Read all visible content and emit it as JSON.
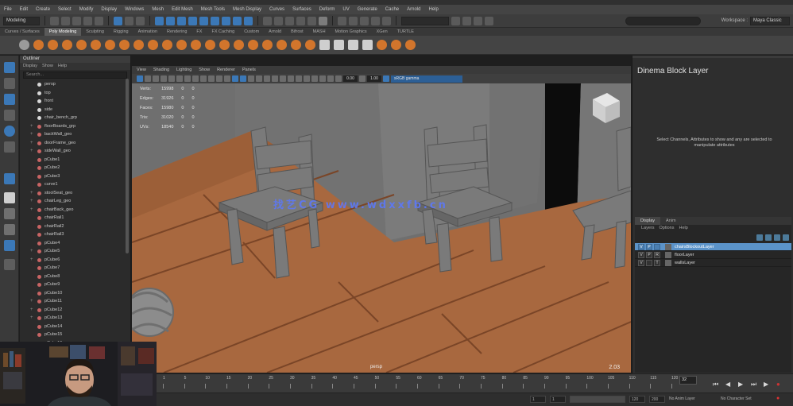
{
  "menubar": {
    "items": [
      "File",
      "Edit",
      "Create",
      "Select",
      "Modify",
      "Display",
      "Windows",
      "Mesh",
      "Edit Mesh",
      "Mesh Tools",
      "Mesh Display",
      "Curves",
      "Surfaces",
      "Deform",
      "UV",
      "Generate",
      "Cache",
      "Arnold",
      "Help"
    ]
  },
  "statusline": {
    "mode_value": "Modeling",
    "workspace_label": "Workspace :",
    "workspace_value": "Maya Classic"
  },
  "shelf_tabs": [
    "Curves / Surfaces",
    "Poly Modeling",
    "Sculpting",
    "Rigging",
    "Animation",
    "Rendering",
    "FX",
    "FX Caching",
    "Custom",
    "Arnold",
    "Bifrost",
    "MASH",
    "Motion Graphics",
    "XGen",
    "TURTLE"
  ],
  "active_shelf_tab_index": 1,
  "outliner": {
    "title": "Outliner",
    "menu": [
      "Display",
      "Show",
      "Help"
    ],
    "search_placeholder": "Search...",
    "items": [
      {
        "label": "persp",
        "expand": false,
        "icon": "camera"
      },
      {
        "label": "top",
        "expand": false,
        "icon": "camera"
      },
      {
        "label": "front",
        "expand": false,
        "icon": "camera"
      },
      {
        "label": "side",
        "expand": false,
        "icon": "camera"
      },
      {
        "label": "chair_bench_grp",
        "expand": false,
        "icon": "camera"
      },
      {
        "label": "floorBoards_grp",
        "expand": true,
        "icon": "mesh"
      },
      {
        "label": "backWall_geo",
        "expand": true,
        "icon": "mesh"
      },
      {
        "label": "doorFrame_geo",
        "expand": true,
        "icon": "mesh"
      },
      {
        "label": "sideWall_geo",
        "expand": true,
        "icon": "mesh"
      },
      {
        "label": "pCube1",
        "expand": false,
        "icon": "mesh"
      },
      {
        "label": "pCube2",
        "expand": false,
        "icon": "mesh"
      },
      {
        "label": "pCube3",
        "expand": false,
        "icon": "mesh"
      },
      {
        "label": "curve1",
        "expand": false,
        "icon": "curve"
      },
      {
        "label": "stoolSeat_geo",
        "expand": true,
        "icon": "mesh"
      },
      {
        "label": "chairLeg_geo",
        "expand": true,
        "icon": "mesh"
      },
      {
        "label": "chairBack_geo",
        "expand": true,
        "icon": "mesh"
      },
      {
        "label": "chairRail1",
        "expand": false,
        "icon": "mesh"
      },
      {
        "label": "chairRail2",
        "expand": false,
        "icon": "mesh"
      },
      {
        "label": "chairRail3",
        "expand": false,
        "icon": "mesh"
      },
      {
        "label": "pCube4",
        "expand": false,
        "icon": "mesh"
      },
      {
        "label": "pCube5",
        "expand": true,
        "icon": "mesh"
      },
      {
        "label": "pCube6",
        "expand": true,
        "icon": "mesh"
      },
      {
        "label": "pCube7",
        "expand": false,
        "icon": "mesh"
      },
      {
        "label": "pCube8",
        "expand": false,
        "icon": "mesh"
      },
      {
        "label": "pCube9",
        "expand": false,
        "icon": "mesh"
      },
      {
        "label": "pCube10",
        "expand": false,
        "icon": "mesh"
      },
      {
        "label": "pCube11",
        "expand": true,
        "icon": "mesh"
      },
      {
        "label": "pCube12",
        "expand": true,
        "icon": "mesh"
      },
      {
        "label": "pCube13",
        "expand": true,
        "icon": "mesh"
      },
      {
        "label": "pCube14",
        "expand": false,
        "icon": "mesh"
      },
      {
        "label": "pCube15",
        "expand": false,
        "icon": "mesh"
      },
      {
        "label": "pCube16",
        "expand": false,
        "icon": "mesh"
      }
    ]
  },
  "viewport": {
    "menu": [
      "View",
      "Shading",
      "Lighting",
      "Show",
      "Renderer",
      "Panels"
    ],
    "field1": "0.00",
    "field2": "1.00",
    "camera_value": "sRGB gamma",
    "hud": [
      {
        "k": "Verts:",
        "v": "15998",
        "a": "0",
        "b": "0"
      },
      {
        "k": "Edges:",
        "v": "31926",
        "a": "0",
        "b": "0"
      },
      {
        "k": "Faces:",
        "v": "15980",
        "a": "0",
        "b": "0"
      },
      {
        "k": "Tris:",
        "v": "31020",
        "a": "0",
        "b": "0"
      },
      {
        "k": "UVs:",
        "v": "18540",
        "a": "0",
        "b": "0"
      }
    ],
    "camera_label": "persp",
    "fps": "2.03",
    "watermark": "找艺CG  www.wdxxfb.cn"
  },
  "right_panel": {
    "title": "Dinema Block Layer",
    "message": "Select Channels, Attributes to show and any are selected to manipulate attributes"
  },
  "layers": {
    "tabs": [
      "Display",
      "Anim"
    ],
    "menu": [
      "Layers",
      "Options",
      "Help"
    ],
    "rows": [
      {
        "v": "V",
        "p": "P",
        "r": "",
        "name": "chairsBlockoutLayer",
        "selected": true
      },
      {
        "v": "V",
        "p": "P",
        "r": "R",
        "name": "floorLayer",
        "selected": false
      },
      {
        "v": "V",
        "p": "",
        "r": "T",
        "name": "wallsLayer",
        "selected": false
      }
    ]
  },
  "timeline": {
    "ticks": [
      "1",
      "5",
      "10",
      "15",
      "20",
      "25",
      "30",
      "35",
      "40",
      "45",
      "50",
      "55",
      "60",
      "65",
      "70",
      "75",
      "80",
      "85",
      "90",
      "95",
      "100",
      "105",
      "110",
      "115",
      "120"
    ],
    "current_frame": "32"
  },
  "rangebar": {
    "start": "1",
    "range_start": "1",
    "range_end": "120",
    "end": "200",
    "anim_layer": "No Anim Layer",
    "char_set": "No Character Set"
  },
  "colors": {
    "accent": "#5b93c9",
    "floor": "#a8683f",
    "wall": "#6e6e6e",
    "chair": "#7a7a7a",
    "maya_bg": "#444444"
  }
}
